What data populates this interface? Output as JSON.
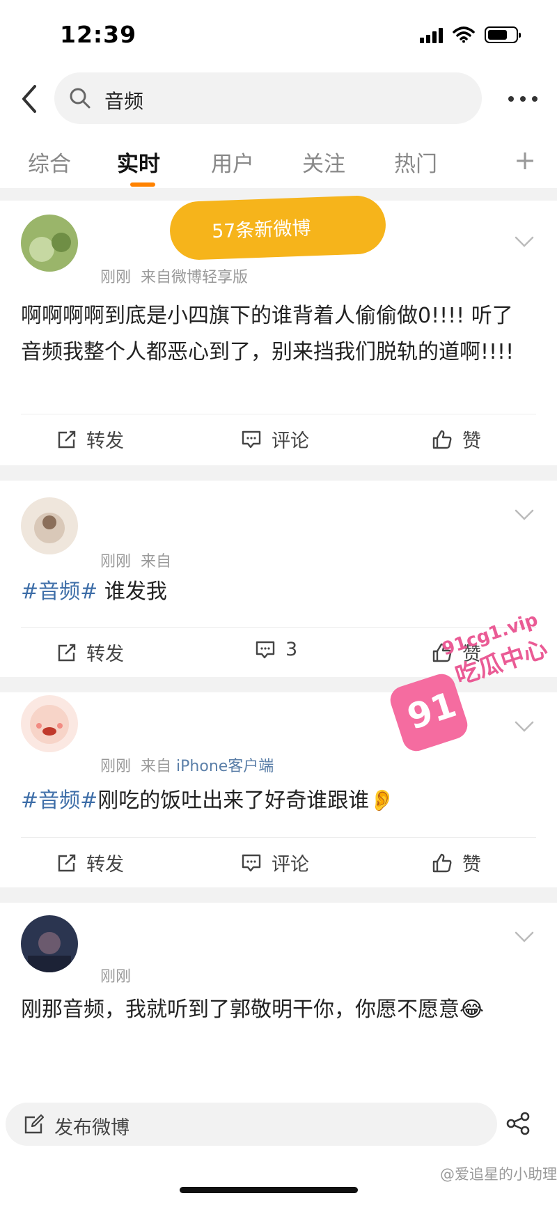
{
  "status_bar": {
    "time": "12:39"
  },
  "search": {
    "query": "音频"
  },
  "tabs": [
    {
      "label": "综合",
      "active": false
    },
    {
      "label": "实时",
      "active": true
    },
    {
      "label": "用户",
      "active": false
    },
    {
      "label": "关注",
      "active": false
    },
    {
      "label": "热门",
      "active": false
    }
  ],
  "new_banner": "57条新微博",
  "posts": [
    {
      "time": "刚刚",
      "source": "来自微博轻享版",
      "content": "啊啊啊啊到底是小四旗下的谁背着人偷偷做0!!!!  听了音频我整个人都恶心到了，别来挡我们脱轨的道啊!!!!",
      "repost": "转发",
      "comment": "评论",
      "like": "赞"
    },
    {
      "time": "刚刚",
      "source": "来自",
      "hashtag": "#音频#",
      "content": " 谁发我",
      "repost": "转发",
      "comment": "3",
      "like": "赞"
    },
    {
      "time": "刚刚",
      "source_prefix": "来自",
      "source": "iPhone客户端",
      "hashtag": "#音频#",
      "content": "刚吃的饭吐出来了好奇谁跟谁👂",
      "repost": "转发",
      "comment": "评论",
      "like": "赞"
    },
    {
      "time": "刚刚",
      "content": "刚那音频，我就听到了郭敬明干你，你愿不愿意😂"
    }
  ],
  "compose": {
    "label": "发布微博"
  },
  "footer_watermark": "@爱追星的小助理",
  "site_logo": {
    "number": "91",
    "domain": "91cg1.vip",
    "name": "吃瓜中心"
  },
  "colors": {
    "accent": "#ff8200",
    "banner": "#f6b41b",
    "hashtag": "#3e6ea8",
    "logo": "#f56ca0"
  }
}
